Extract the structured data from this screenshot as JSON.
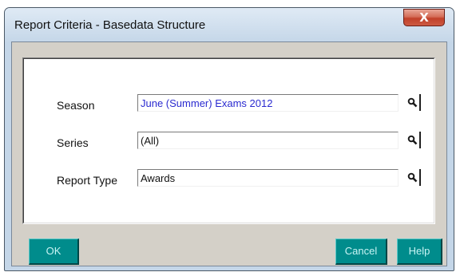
{
  "window": {
    "title": "Report Criteria - Basedata Structure",
    "close_label": "X"
  },
  "fields": {
    "season": {
      "label": "Season",
      "value": "June (Summer) Exams 2012"
    },
    "series": {
      "label": "Series",
      "value": "(All)"
    },
    "report_type": {
      "label": "Report Type",
      "value": "Awards"
    }
  },
  "buttons": {
    "ok": "OK",
    "cancel": "Cancel",
    "help": "Help"
  },
  "icons": {
    "lookup": "magnifier-icon"
  },
  "colors": {
    "button_face": "#008c8c",
    "dialog_face": "#d4d0c8",
    "season_text": "#2a2ad0"
  }
}
